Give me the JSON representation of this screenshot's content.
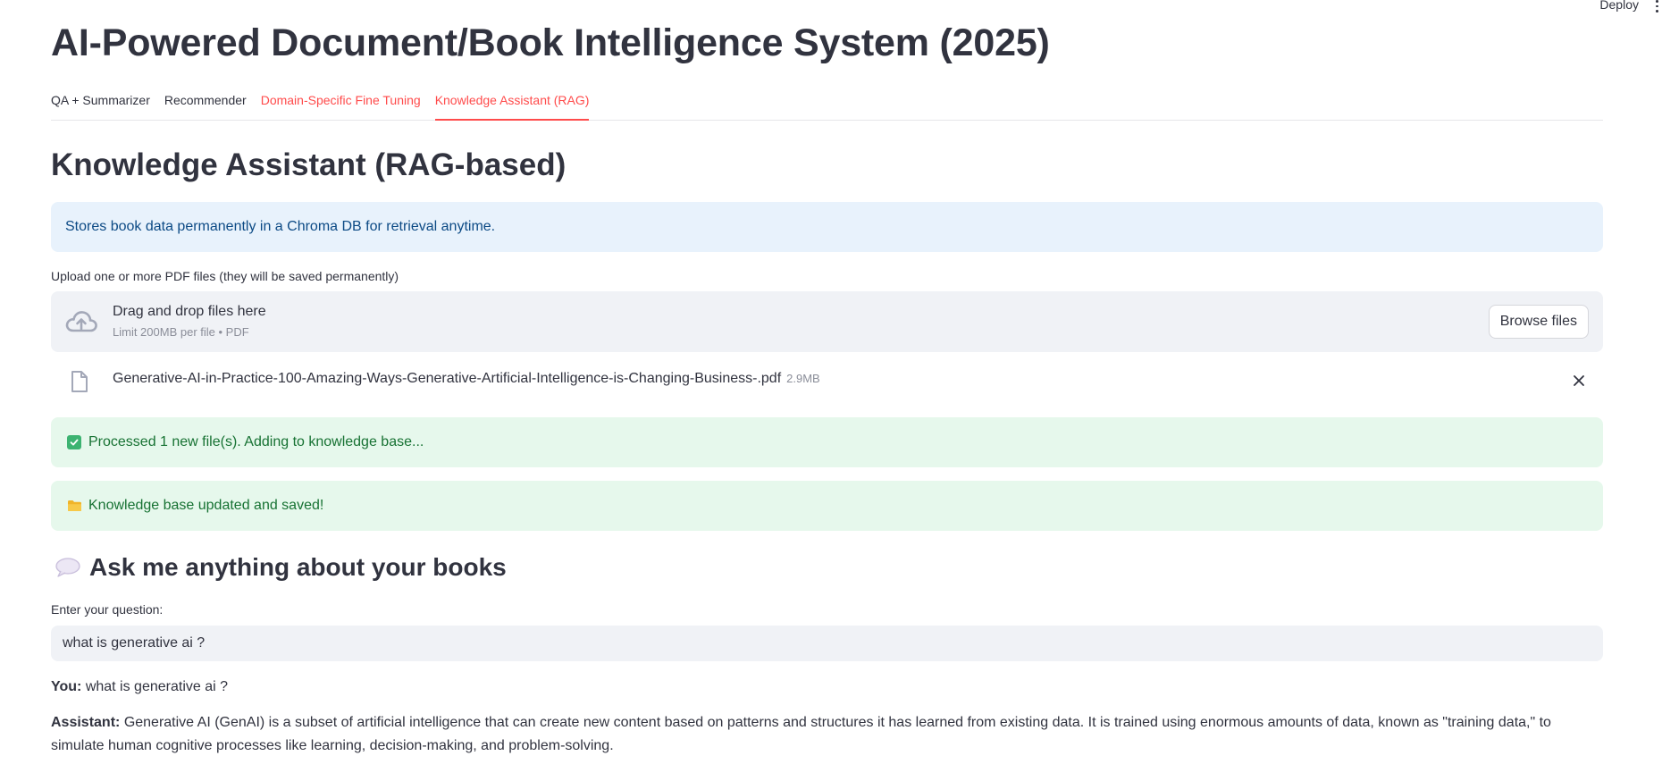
{
  "header": {
    "deploy_label": "Deploy",
    "menu_icon": "kebab-vertical-icon"
  },
  "app": {
    "title": "AI-Powered Document/Book Intelligence System (2025)"
  },
  "tabs": [
    {
      "label": "QA + Summarizer",
      "state": "normal"
    },
    {
      "label": "Recommender",
      "state": "normal"
    },
    {
      "label": "Domain-Specific Fine Tuning",
      "state": "hover"
    },
    {
      "label": "Knowledge Assistant (RAG)",
      "state": "active"
    }
  ],
  "section": {
    "title": "Knowledge Assistant (RAG-based)",
    "info": "Stores book data permanently in a Chroma DB for retrieval anytime."
  },
  "uploader": {
    "label": "Upload one or more PDF files (they will be saved permanently)",
    "drop_title": "Drag and drop files here",
    "limit": "Limit 200MB per file • PDF",
    "browse_label": "Browse files",
    "icon": "cloud-upload-icon"
  },
  "uploaded_file": {
    "name": "Generative-AI-in-Practice-100-Amazing-Ways-Generative-Artificial-Intelligence-is-Changing-Business-.pdf",
    "size": "2.9MB",
    "icon": "file-icon"
  },
  "messages": {
    "processed": "Processed 1 new file(s). Adding to knowledge base...",
    "updated": "Knowledge base updated and saved!"
  },
  "ask": {
    "title": "Ask me anything about your books",
    "question_label": "Enter your question:",
    "question_value": "what is generative ai ?"
  },
  "chat": {
    "you_label": "You:",
    "you_text": "what is generative ai ?",
    "assistant_label": "Assistant:",
    "assistant_text": "Generative AI (GenAI) is a subset of artificial intelligence that can create new content based on patterns and structures it has learned from existing data. It is trained using enormous amounts of data, known as \"training data,\" to simulate human cognitive processes like learning, decision-making, and problem-solving."
  },
  "colors": {
    "accent": "#ff4b4b",
    "info_bg": "#e8f2fc",
    "info_text": "#0c4a85",
    "success_bg": "#e6f8ec",
    "success_text": "#177233",
    "widget_bg": "#f0f2f6"
  }
}
